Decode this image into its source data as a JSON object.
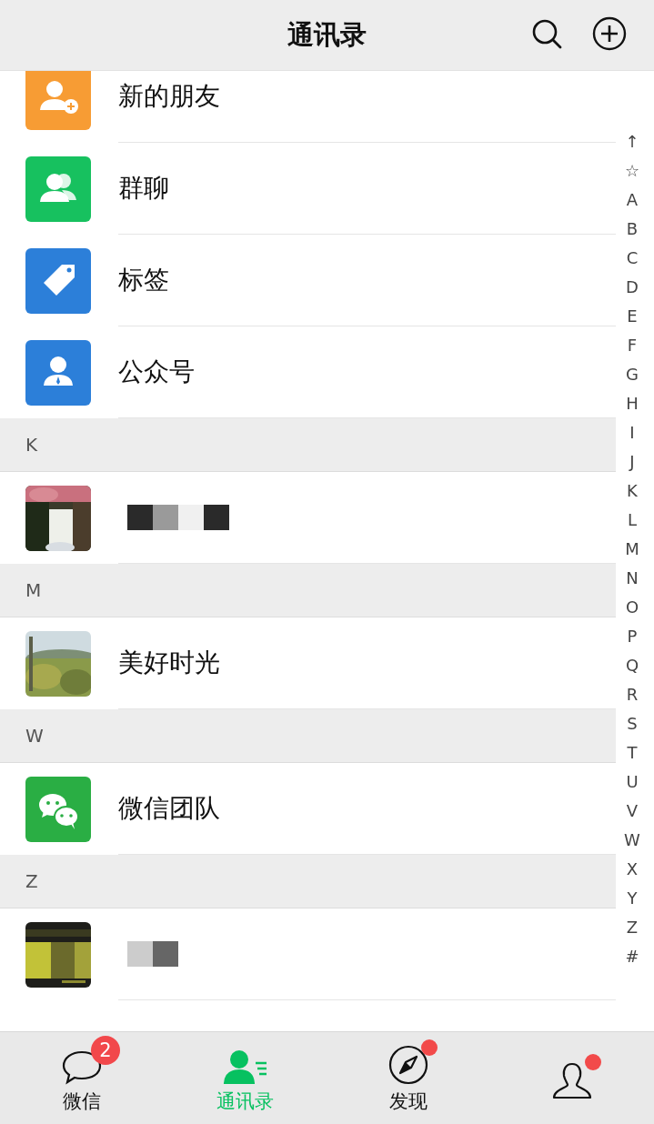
{
  "header": {
    "title": "通讯录"
  },
  "functions": [
    {
      "kind": "new-friend",
      "label": "新的朋友",
      "color": "#f79c34"
    },
    {
      "kind": "group",
      "label": "群聊",
      "color": "#17c15f"
    },
    {
      "kind": "tag",
      "label": "标签",
      "color": "#2c7fd9"
    },
    {
      "kind": "official",
      "label": "公众号",
      "color": "#2c7fd9"
    }
  ],
  "sections": [
    {
      "letter": "K",
      "contacts": [
        {
          "kind": "picture",
          "name_redacted": true
        }
      ]
    },
    {
      "letter": "M",
      "contacts": [
        {
          "kind": "picture",
          "name": "美好时光"
        }
      ]
    },
    {
      "letter": "W",
      "contacts": [
        {
          "kind": "official",
          "name": "微信团队"
        }
      ]
    },
    {
      "letter": "Z",
      "contacts": [
        {
          "kind": "picture",
          "name_redacted": true
        }
      ]
    }
  ],
  "index_bar": [
    "↑",
    "☆",
    "A",
    "B",
    "C",
    "D",
    "E",
    "F",
    "G",
    "H",
    "I",
    "J",
    "K",
    "L",
    "M",
    "N",
    "O",
    "P",
    "Q",
    "R",
    "S",
    "T",
    "U",
    "V",
    "W",
    "X",
    "Y",
    "Z",
    "#"
  ],
  "tabs": [
    {
      "kind": "chats",
      "label": "微信",
      "selected": false,
      "badge": "2",
      "dot": false
    },
    {
      "kind": "contacts",
      "label": "通讯录",
      "selected": true,
      "dot": false
    },
    {
      "kind": "discover",
      "label": "发现",
      "selected": false,
      "dot": true
    },
    {
      "kind": "me",
      "selected": false,
      "dot": true
    }
  ]
}
